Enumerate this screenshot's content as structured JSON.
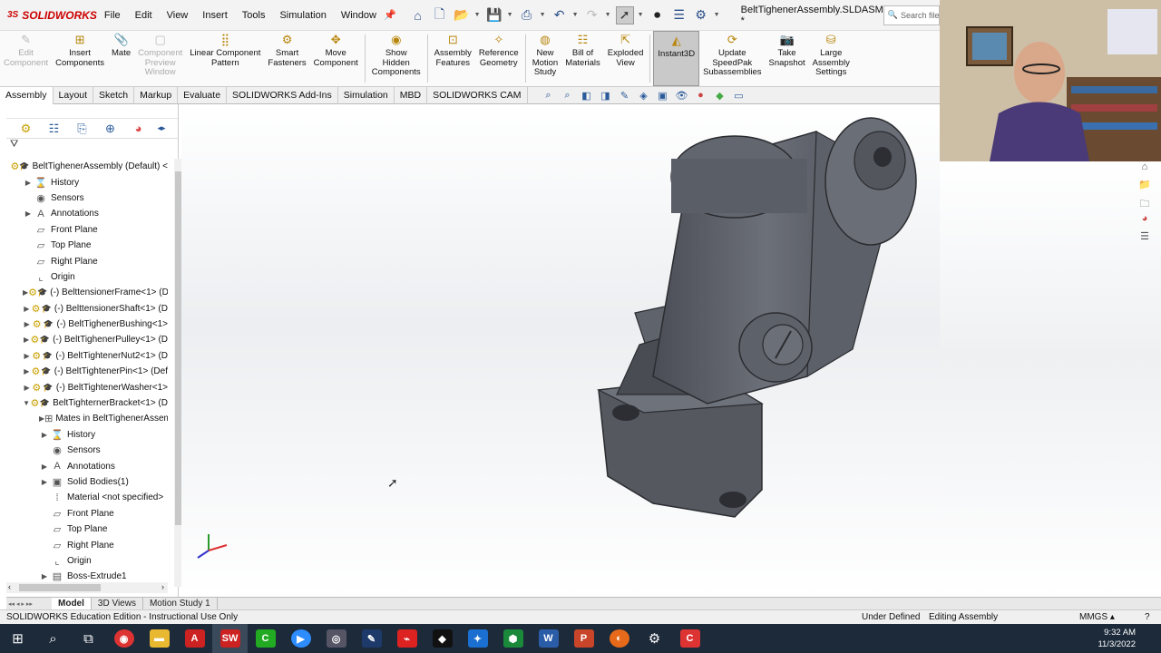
{
  "app": {
    "logo": "SOLIDWORKS",
    "document_title": "BeltTighenerAssembly.SLDASM *"
  },
  "menu": [
    "File",
    "Edit",
    "View",
    "Insert",
    "Tools",
    "Simulation",
    "Window"
  ],
  "search": {
    "placeholder": "Search files and m"
  },
  "commands": [
    {
      "label": "Edit\nComponent",
      "icon": "edit-component-icon",
      "disabled": true
    },
    {
      "label": "Insert\nComponents",
      "icon": "insert-components-icon",
      "disabled": false
    },
    {
      "label": "Mate",
      "icon": "mate-icon",
      "disabled": false
    },
    {
      "label": "Component\nPreview\nWindow",
      "icon": "component-preview-icon",
      "disabled": true
    },
    {
      "label": "Linear Component\nPattern",
      "icon": "linear-pattern-icon",
      "disabled": false
    },
    {
      "label": "Smart\nFasteners",
      "icon": "smart-fasteners-icon",
      "disabled": false
    },
    {
      "label": "Move\nComponent",
      "icon": "move-component-icon",
      "disabled": false
    },
    {
      "label": "Show\nHidden\nComponents",
      "icon": "show-hidden-icon",
      "disabled": false
    },
    {
      "label": "Assembly\nFeatures",
      "icon": "assembly-features-icon",
      "disabled": false
    },
    {
      "label": "Reference\nGeometry",
      "icon": "reference-geometry-icon",
      "disabled": false
    },
    {
      "label": "New\nMotion\nStudy",
      "icon": "motion-study-icon",
      "disabled": false
    },
    {
      "label": "Bill of\nMaterials",
      "icon": "bom-icon",
      "disabled": false
    },
    {
      "label": "Exploded\nView",
      "icon": "exploded-view-icon",
      "disabled": false
    },
    {
      "label": "Instant3D",
      "icon": "instant3d-icon",
      "disabled": false,
      "active": true
    },
    {
      "label": "Update\nSpeedPak\nSubassemblies",
      "icon": "speedpak-icon",
      "disabled": false
    },
    {
      "label": "Take\nSnapshot",
      "icon": "camera-icon",
      "disabled": false
    },
    {
      "label": "Large\nAssembly\nSettings",
      "icon": "large-assembly-icon",
      "disabled": false
    }
  ],
  "tabs": [
    "Assembly",
    "Layout",
    "Sketch",
    "Markup",
    "Evaluate",
    "SOLIDWORKS Add-Ins",
    "Simulation",
    "MBD",
    "SOLIDWORKS CAM"
  ],
  "active_tab": "Assembly",
  "tree": [
    {
      "label": "BeltTighenerAssembly (Default) <",
      "level": 0,
      "exp": "",
      "icon": "assembly-icon"
    },
    {
      "label": "History",
      "level": 1,
      "exp": "▶",
      "icon": "history-icon"
    },
    {
      "label": "Sensors",
      "level": 1,
      "exp": "",
      "icon": "sensor-icon"
    },
    {
      "label": "Annotations",
      "level": 1,
      "exp": "▶",
      "icon": "annotation-icon"
    },
    {
      "label": "Front Plane",
      "level": 1,
      "exp": "",
      "icon": "plane-icon"
    },
    {
      "label": "Top Plane",
      "level": 1,
      "exp": "",
      "icon": "plane-icon"
    },
    {
      "label": "Right Plane",
      "level": 1,
      "exp": "",
      "icon": "plane-icon"
    },
    {
      "label": "Origin",
      "level": 1,
      "exp": "",
      "icon": "origin-icon"
    },
    {
      "label": "(-) BelttensionerFrame<1> (D",
      "level": 1,
      "exp": "▶",
      "icon": "part-icon"
    },
    {
      "label": "(-) BelttensionerShaft<1> (D",
      "level": 1,
      "exp": "▶",
      "icon": "part-icon"
    },
    {
      "label": "(-) BeltTighenerBushing<1>",
      "level": 1,
      "exp": "▶",
      "icon": "part-icon"
    },
    {
      "label": "(-) BeltTighenerPulley<1> (D",
      "level": 1,
      "exp": "▶",
      "icon": "part-icon"
    },
    {
      "label": "(-) BeltTightenerNut2<1> (D",
      "level": 1,
      "exp": "▶",
      "icon": "part-icon"
    },
    {
      "label": "(-) BeltTightenerPin<1> (Def",
      "level": 1,
      "exp": "▶",
      "icon": "part-icon"
    },
    {
      "label": "(-) BeltTightenerWasher<1>",
      "level": 1,
      "exp": "▶",
      "icon": "part-icon"
    },
    {
      "label": "BeltTighternerBracket<1> (D",
      "level": 1,
      "exp": "▼",
      "icon": "part-icon"
    },
    {
      "label": "Mates in BeltTighenerAssembl",
      "level": 2,
      "exp": "▶",
      "icon": "mates-icon"
    },
    {
      "label": "History",
      "level": 2,
      "exp": "▶",
      "icon": "history-icon"
    },
    {
      "label": "Sensors",
      "level": 2,
      "exp": "",
      "icon": "sensor-icon"
    },
    {
      "label": "Annotations",
      "level": 2,
      "exp": "▶",
      "icon": "annotation-icon"
    },
    {
      "label": "Solid Bodies(1)",
      "level": 2,
      "exp": "▶",
      "icon": "solid-body-icon"
    },
    {
      "label": "Material <not specified>",
      "level": 2,
      "exp": "",
      "icon": "material-icon"
    },
    {
      "label": "Front Plane",
      "level": 2,
      "exp": "",
      "icon": "plane-icon"
    },
    {
      "label": "Top Plane",
      "level": 2,
      "exp": "",
      "icon": "plane-icon"
    },
    {
      "label": "Right Plane",
      "level": 2,
      "exp": "",
      "icon": "plane-icon"
    },
    {
      "label": "Origin",
      "level": 2,
      "exp": "",
      "icon": "origin-icon"
    },
    {
      "label": "Boss-Extrude1",
      "level": 2,
      "exp": "▶",
      "icon": "extrude-icon"
    }
  ],
  "bottom_tabs": [
    "Model",
    "3D Views",
    "Motion Study 1"
  ],
  "status": {
    "edition": "SOLIDWORKS Education Edition - Instructional Use Only",
    "state": "Under Defined",
    "mode": "Editing Assembly",
    "units": "MMGS"
  },
  "clock": {
    "time": "9:32 AM",
    "date": "11/3/2022"
  },
  "colors": {
    "brand": "#cc0000",
    "viewport_bg": "#eceef1",
    "taskbar": "#1c2a3a"
  }
}
